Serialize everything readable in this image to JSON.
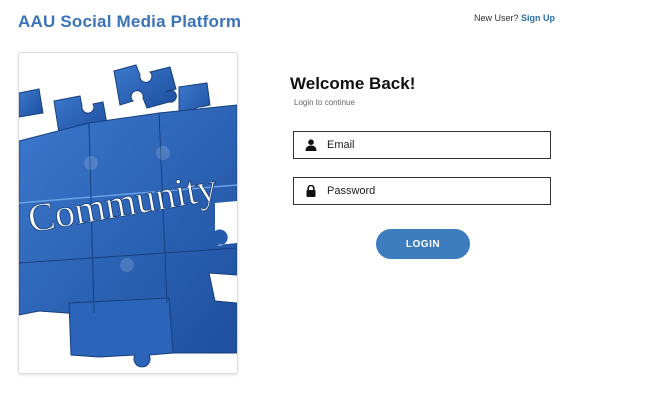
{
  "header": {
    "brand": "AAU Social Media Platform",
    "new_user_text": "New User?",
    "signup_link": "Sign Up"
  },
  "hero": {
    "image_caption": "Community"
  },
  "login": {
    "title": "Welcome Back!",
    "subtitle": "Login to continue",
    "email_placeholder": "Email",
    "password_placeholder": "Password",
    "button_label": "LOGIN"
  },
  "colors": {
    "brand": "#3a73b8",
    "button": "#3d7cbf",
    "puzzle": "#2a5fb0"
  }
}
